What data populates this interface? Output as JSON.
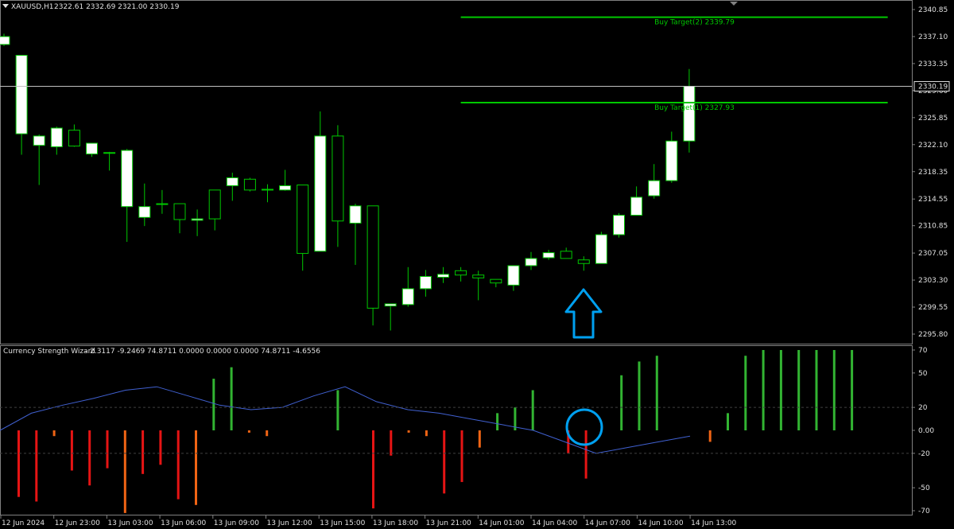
{
  "header": {
    "symbol": "XAUUSD,H1",
    "ohlc": "2322.61 2332.69 2321.00 2330.19",
    "menu_icon": "triangle-down-icon"
  },
  "indicator": {
    "name": "Currency Strength Wizard",
    "values": "- 2.3117 -9.2469 74.8711 0.0000 0.0000 0.0000 74.8711 -4.6556"
  },
  "colors": {
    "background": "#000000",
    "bull_candle": "#ffffff",
    "bear_candle": "#000000",
    "candle_outline": "#00c800",
    "target_line": "#00c800",
    "bid_line": "#c0c0c0",
    "hist_positive": "#32b432",
    "hist_negative_strong": "#e61414",
    "hist_negative_weak": "#f06414",
    "strength_line": "#4060d0",
    "annotation": "#00a0f0"
  },
  "annotations": {
    "arrow_icon": "up-arrow-icon",
    "circle_icon": "circle-highlight-icon"
  },
  "chart_data": [
    {
      "type": "candlestick",
      "title": "XAUUSD,H1",
      "ylim": [
        2293.6,
        2341.0
      ],
      "y_ticks": [
        "2340.85",
        "2337.10",
        "2333.35",
        "2329.60",
        "2325.85",
        "2322.10",
        "2318.35",
        "2314.55",
        "2310.85",
        "2307.05",
        "2303.30",
        "2299.55",
        "2295.80"
      ],
      "current_price": "2330.19",
      "x_ticks": [
        "12 Jun 2024",
        "12 Jun 23:00",
        "13 Jun 03:00",
        "13 Jun 06:00",
        "13 Jun 09:00",
        "13 Jun 12:00",
        "13 Jun 15:00",
        "13 Jun 18:00",
        "13 Jun 21:00",
        "14 Jun 01:00",
        "14 Jun 04:00",
        "14 Jun 07:00",
        "14 Jun 10:00",
        "14 Jun 13:00"
      ],
      "candles": [
        {
          "o": 2336.0,
          "h": 2337.5,
          "l": 2335.8,
          "c": 2337.1
        },
        {
          "o": 2323.6,
          "h": 2334.5,
          "l": 2320.7,
          "c": 2334.5
        },
        {
          "o": 2322.0,
          "h": 2323.5,
          "l": 2316.5,
          "c": 2323.3
        },
        {
          "o": 2321.8,
          "h": 2324.6,
          "l": 2320.7,
          "c": 2324.4
        },
        {
          "o": 2324.1,
          "h": 2324.9,
          "l": 2321.8,
          "c": 2321.9
        },
        {
          "o": 2320.8,
          "h": 2322.3,
          "l": 2320.4,
          "c": 2322.3
        },
        {
          "o": 2321.0,
          "h": 2321.1,
          "l": 2318.5,
          "c": 2320.9
        },
        {
          "o": 2313.5,
          "h": 2321.5,
          "l": 2308.6,
          "c": 2321.3
        },
        {
          "o": 2312.0,
          "h": 2316.7,
          "l": 2310.8,
          "c": 2313.5
        },
        {
          "o": 2313.8,
          "h": 2315.8,
          "l": 2312.5,
          "c": 2313.9
        },
        {
          "o": 2313.9,
          "h": 2313.9,
          "l": 2309.8,
          "c": 2311.7
        },
        {
          "o": 2311.6,
          "h": 2313.1,
          "l": 2309.4,
          "c": 2311.8
        },
        {
          "o": 2315.8,
          "h": 2315.8,
          "l": 2310.2,
          "c": 2311.8
        },
        {
          "o": 2316.4,
          "h": 2318.2,
          "l": 2314.3,
          "c": 2317.5
        },
        {
          "o": 2317.3,
          "h": 2317.5,
          "l": 2315.6,
          "c": 2315.8
        },
        {
          "o": 2315.8,
          "h": 2316.6,
          "l": 2314.1,
          "c": 2315.9
        },
        {
          "o": 2315.8,
          "h": 2318.6,
          "l": 2315.7,
          "c": 2316.4
        },
        {
          "o": 2316.5,
          "h": 2316.5,
          "l": 2304.6,
          "c": 2307.0
        },
        {
          "o": 2307.3,
          "h": 2326.7,
          "l": 2307.3,
          "c": 2323.3
        },
        {
          "o": 2323.3,
          "h": 2324.8,
          "l": 2307.9,
          "c": 2311.5
        },
        {
          "o": 2311.2,
          "h": 2313.9,
          "l": 2305.4,
          "c": 2313.6
        },
        {
          "o": 2313.6,
          "h": 2313.6,
          "l": 2297.0,
          "c": 2299.4
        },
        {
          "o": 2299.7,
          "h": 2300.0,
          "l": 2296.3,
          "c": 2300.0
        },
        {
          "o": 2299.9,
          "h": 2305.1,
          "l": 2299.6,
          "c": 2302.1
        },
        {
          "o": 2302.1,
          "h": 2304.7,
          "l": 2301.0,
          "c": 2303.8
        },
        {
          "o": 2303.7,
          "h": 2305.1,
          "l": 2302.9,
          "c": 2304.1
        },
        {
          "o": 2304.6,
          "h": 2305.1,
          "l": 2303.1,
          "c": 2304.0
        },
        {
          "o": 2304.0,
          "h": 2304.6,
          "l": 2300.5,
          "c": 2303.6
        },
        {
          "o": 2303.4,
          "h": 2303.4,
          "l": 2302.3,
          "c": 2302.9
        },
        {
          "o": 2302.6,
          "h": 2305.3,
          "l": 2301.8,
          "c": 2305.3
        },
        {
          "o": 2305.3,
          "h": 2307.2,
          "l": 2304.7,
          "c": 2306.3
        },
        {
          "o": 2306.4,
          "h": 2307.5,
          "l": 2306.1,
          "c": 2307.1
        },
        {
          "o": 2307.3,
          "h": 2307.8,
          "l": 2306.3,
          "c": 2306.3
        },
        {
          "o": 2306.1,
          "h": 2306.6,
          "l": 2304.6,
          "c": 2305.6
        },
        {
          "o": 2305.6,
          "h": 2310.0,
          "l": 2305.6,
          "c": 2309.6
        },
        {
          "o": 2309.6,
          "h": 2312.6,
          "l": 2309.2,
          "c": 2312.3
        },
        {
          "o": 2312.3,
          "h": 2316.3,
          "l": 2312.3,
          "c": 2314.8
        },
        {
          "o": 2315.0,
          "h": 2319.4,
          "l": 2314.6,
          "c": 2317.1
        },
        {
          "o": 2317.1,
          "h": 2323.9,
          "l": 2316.8,
          "c": 2322.6
        },
        {
          "o": 2322.6,
          "h": 2332.6,
          "l": 2321.0,
          "c": 2330.2
        }
      ],
      "levels": [
        {
          "name": "Buy Target(2)",
          "value": 2339.79,
          "label": "Buy Target(2) 2339.79"
        },
        {
          "name": "Buy Target(1)",
          "value": 2327.93,
          "label": "Buy Target(1) 2327.93"
        }
      ]
    },
    {
      "type": "bar",
      "title": "Currency Strength Wizard",
      "ylim": [
        -75,
        75
      ],
      "y_ticks": [
        "70",
        "50",
        "20",
        "0.00",
        "-20",
        "-50",
        "-70"
      ],
      "series": [
        {
          "values": [
            -58,
            -62,
            -5,
            -35,
            -48,
            -33,
            -72,
            -38,
            -30,
            -60,
            -65,
            45,
            55,
            -2,
            -5,
            0,
            0,
            0,
            35,
            0,
            -68,
            -22,
            -2,
            -5,
            -55,
            -45,
            -15,
            15,
            20,
            35,
            0,
            -20,
            -42,
            0,
            48,
            60,
            65,
            0,
            0,
            -10,
            15,
            65,
            70,
            70,
            70,
            70,
            70,
            70
          ]
        },
        {
          "values": [
            0,
            15,
            22,
            28,
            35,
            38,
            30,
            22,
            18,
            20,
            30,
            38,
            25,
            18,
            15,
            10,
            5,
            0,
            -10,
            -20,
            -15,
            -10,
            -5
          ]
        }
      ]
    }
  ]
}
